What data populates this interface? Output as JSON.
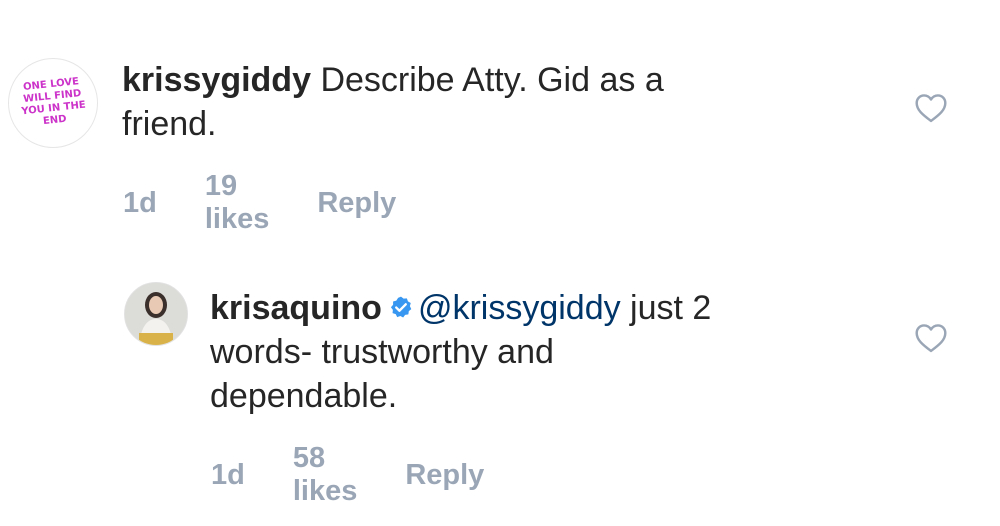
{
  "comments": [
    {
      "username": "krissygiddy",
      "avatar_text": "One love will find you in the end",
      "text_line1": "Describe Atty. Gid as a",
      "text_line2": "friend.",
      "time": "1d",
      "likes": "19 likes",
      "reply_label": "Reply"
    },
    {
      "username": "krisaquino",
      "verified": true,
      "mention": "@krissygiddy",
      "text_line1": " just 2",
      "text_line2": "words- trustworthy and",
      "text_line3": "dependable.",
      "time": "1d",
      "likes": "58 likes",
      "reply_label": "Reply"
    }
  ],
  "colors": {
    "text": "#262626",
    "mention": "#003569",
    "meta": "#9aa6b6",
    "verified": "#3897f0",
    "avatar_art": "#cc33c9"
  },
  "icons": {
    "like": "heart-outline-icon",
    "verified": "verified-badge-icon"
  }
}
